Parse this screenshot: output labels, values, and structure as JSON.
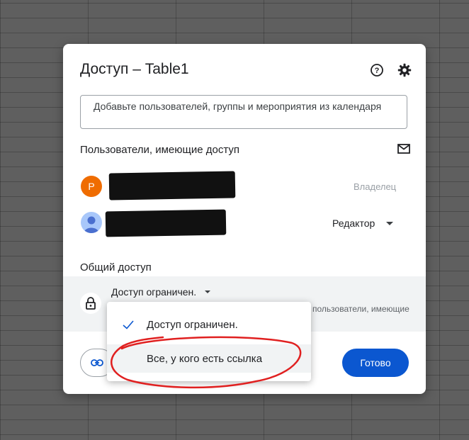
{
  "dialog": {
    "title": "Доступ – Table1",
    "help_icon": "help-circle-icon",
    "settings_icon": "gear-icon"
  },
  "search": {
    "placeholder": "Добавьте пользователей, группы и мероприятия из календаря"
  },
  "people": {
    "title": "Пользователи, имеющие доступ",
    "mail_icon": "mail-icon",
    "users": [
      {
        "avatar_letter": "P",
        "avatar_color": "#ef6c00",
        "role": "Владелец"
      },
      {
        "avatar_icon": "person-icon",
        "avatar_color": "#a8c7fa",
        "role": "Редактор"
      }
    ]
  },
  "general": {
    "title": "Общий доступ",
    "access_value": "Доступ ограничен.",
    "description": "пользователи, имеющие",
    "lock_icon": "lock-icon"
  },
  "footer": {
    "copy_link_icon": "link-icon",
    "done_label": "Готово",
    "done_color": "#0b57d0"
  },
  "dropdown_menu": {
    "items": [
      {
        "label": "Доступ ограничен.",
        "selected": true
      },
      {
        "label": "Все, у кого есть ссылка",
        "selected": false,
        "highlighted": true
      }
    ]
  },
  "colors": {
    "annotation_red": "#e02020",
    "background": "#5f5f5f"
  }
}
